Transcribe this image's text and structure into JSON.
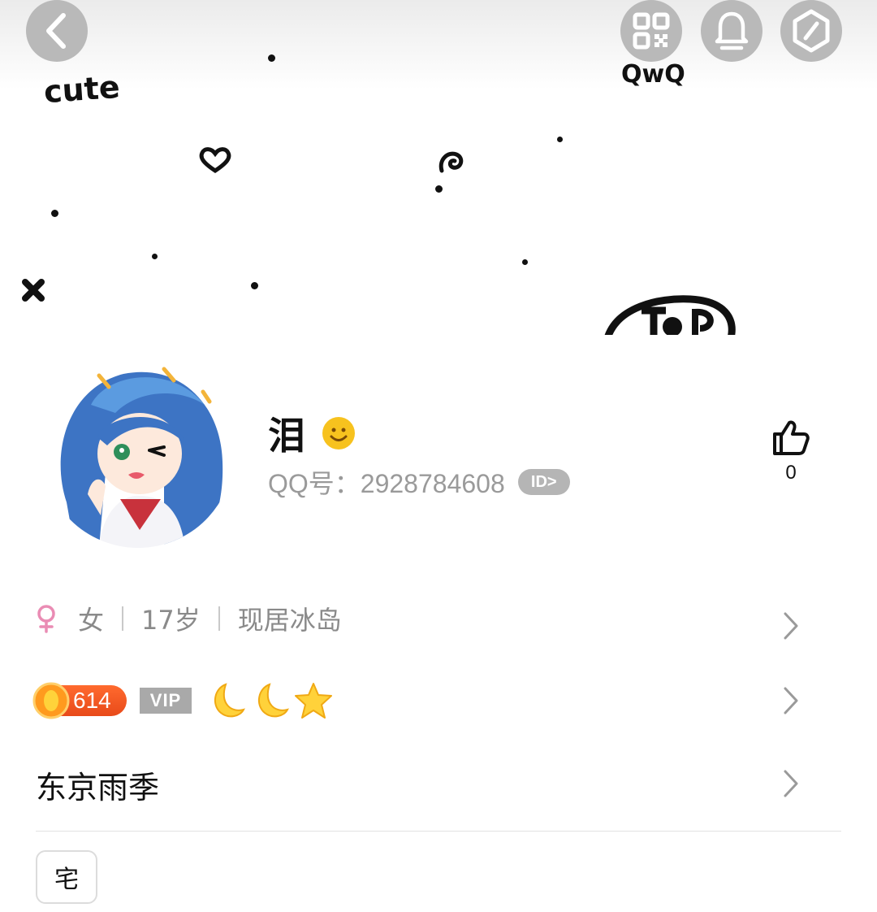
{
  "cover": {
    "doodle_text_left": "cute",
    "doodle_text_right": "QwQ"
  },
  "header": {
    "back_icon": "chevron-left-icon",
    "qr_icon": "qr-code-icon",
    "bell_icon": "bell-icon",
    "more_icon": "hexagon-icon"
  },
  "profile": {
    "nickname": "泪",
    "emoji_icon": "smiley-icon",
    "qq_label": "QQ号：2928784608",
    "id_badge": "ID>",
    "likes": "0"
  },
  "info": {
    "gender": "女",
    "age": "17岁",
    "location": "现居冰岛"
  },
  "badges": {
    "coin_count": "614",
    "vip_label": "VIP",
    "level_icons": [
      "moon-icon",
      "moon-icon",
      "star-icon"
    ]
  },
  "signature": "东京雨季",
  "tags": [
    "宅"
  ]
}
